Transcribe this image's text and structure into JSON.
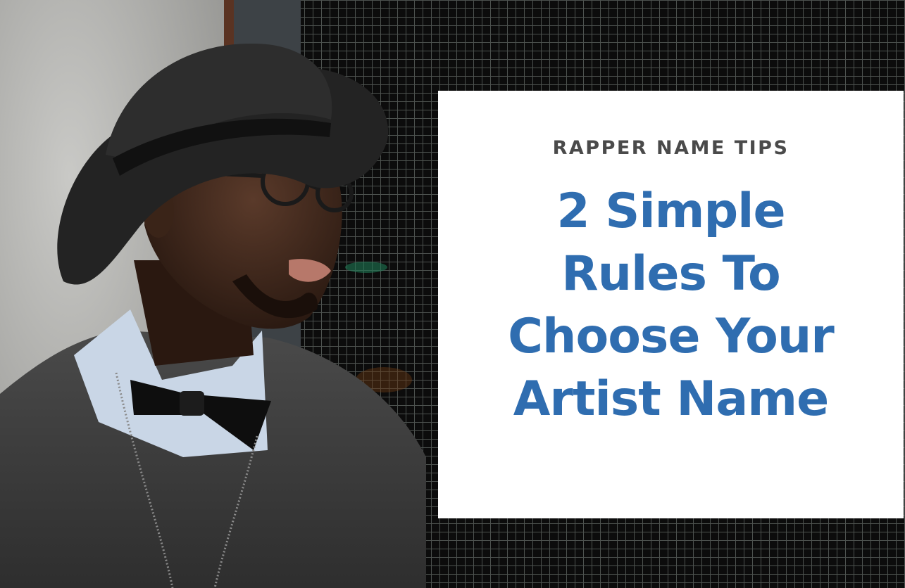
{
  "hero": {
    "kicker": "RAPPER NAME TIPS",
    "headline": [
      "2 Simple",
      "Rules To",
      "Choose Your",
      "Artist Name"
    ],
    "headline_color": "#2f6db0",
    "kicker_color": "#4a4a4a",
    "card_color": "#ffffff"
  },
  "photo": {
    "subject": "man-with-hat-glasses-bowtie",
    "background": "metal-grid-wall"
  }
}
